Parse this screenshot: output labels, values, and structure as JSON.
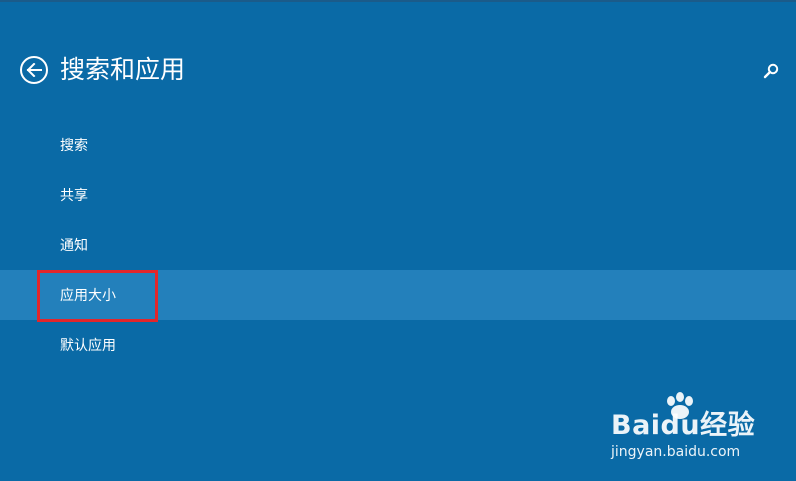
{
  "header": {
    "title": "搜索和应用",
    "back_icon": "back-arrow-icon",
    "search_icon": "search-icon"
  },
  "menu": {
    "items": [
      {
        "label": "搜索",
        "selected": false
      },
      {
        "label": "共享",
        "selected": false
      },
      {
        "label": "通知",
        "selected": false
      },
      {
        "label": "应用大小",
        "selected": true
      },
      {
        "label": "默认应用",
        "selected": false
      }
    ]
  },
  "watermark": {
    "brand": "Baidu经验",
    "url": "jingyan.baidu.com"
  },
  "colors": {
    "background": "#0a6aa6",
    "selected_item": "#2380bb",
    "annotation_box": "#e3262b"
  }
}
